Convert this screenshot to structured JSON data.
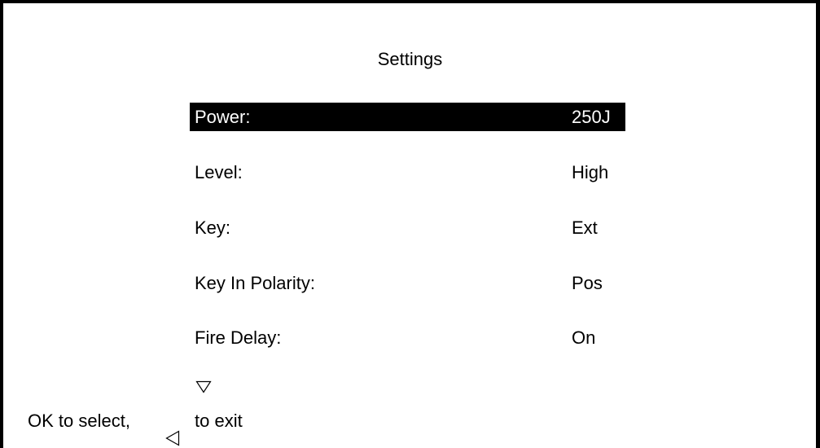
{
  "screen": {
    "title": "Settings"
  },
  "menu": {
    "items": [
      {
        "label": "Power:",
        "value": "250J",
        "selected": true
      },
      {
        "label": "Level:",
        "value": "High",
        "selected": false
      },
      {
        "label": "Key:",
        "value": "Ext",
        "selected": false
      },
      {
        "label": "Key In Polarity:",
        "value": "Pos",
        "selected": false
      },
      {
        "label": "Fire Delay:",
        "value": "On",
        "selected": false
      }
    ]
  },
  "footer": {
    "ok_hint": "OK to select,",
    "exit_hint": "to exit",
    "scroll_down_icon": "triangle-down-icon",
    "back_icon": "triangle-left-icon"
  }
}
